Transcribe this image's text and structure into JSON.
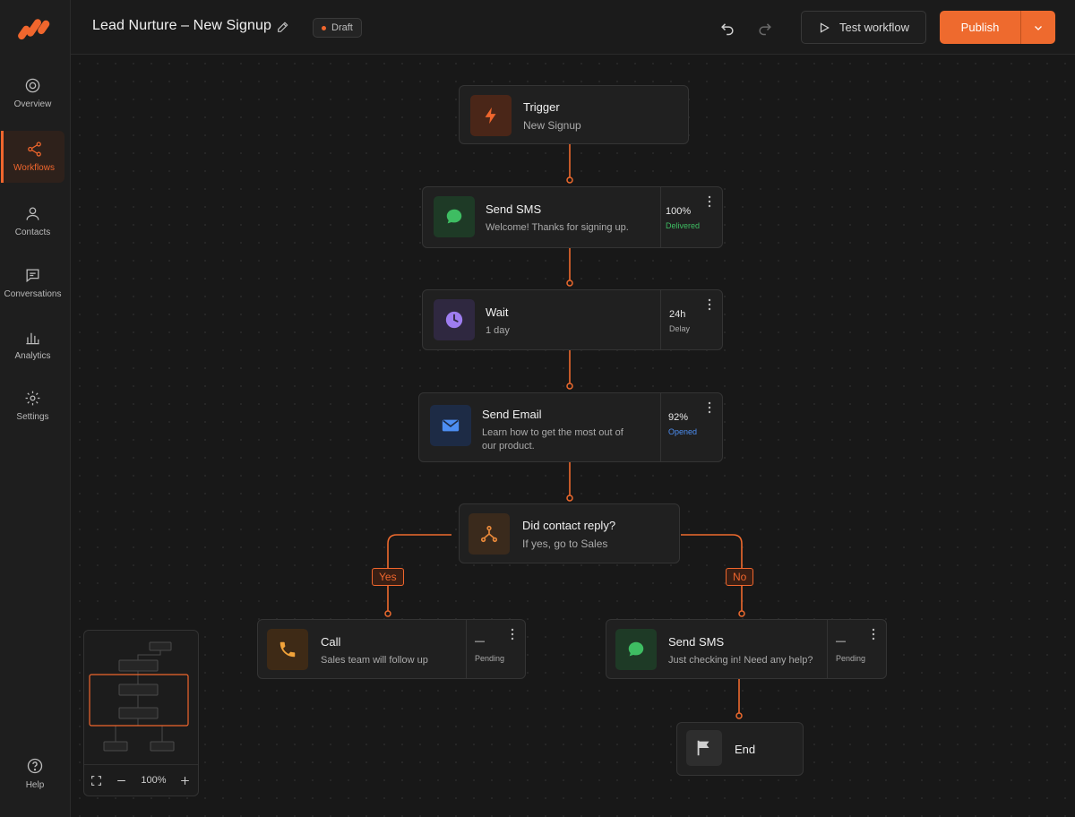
{
  "app": {
    "title": "Lead Nurture – New Signup",
    "status": "Draft",
    "accent": "#ee6a2e"
  },
  "sidebar": {
    "items": [
      {
        "label": "Overview",
        "icon": "target-icon"
      },
      {
        "label": "Workflows",
        "icon": "workflow-icon",
        "active": true
      },
      {
        "label": "Contacts",
        "icon": "user-icon"
      },
      {
        "label": "Conversations",
        "icon": "chat-icon"
      },
      {
        "label": "Analytics",
        "icon": "bar-chart-icon"
      },
      {
        "label": "Settings",
        "icon": "gear-icon"
      }
    ],
    "help": "Help"
  },
  "toolbar": {
    "test_label": "Test workflow",
    "publish_label": "Publish"
  },
  "nodes": {
    "trigger": {
      "title": "Trigger",
      "subtitle": "New Signup"
    },
    "sms1": {
      "title": "Send SMS",
      "subtitle": "Welcome! Thanks for signing up.",
      "stat_value": "100%",
      "stat_label": "Delivered"
    },
    "wait": {
      "title": "Wait",
      "subtitle": "1 day",
      "stat_value": "24h",
      "stat_label": "Delay"
    },
    "email": {
      "title": "Send Email",
      "subtitle": "Learn how to get the most out of our product.",
      "stat_value": "92%",
      "stat_label": "Opened"
    },
    "condition": {
      "title": "Did contact reply?",
      "subtitle": "If yes, go to Sales"
    },
    "call": {
      "title": "Call",
      "subtitle": "Sales team will follow up",
      "stat_value": "—",
      "stat_label": "Pending"
    },
    "sms2": {
      "title": "Send SMS",
      "subtitle": "Just checking in! Need any help?",
      "stat_value": "—",
      "stat_label": "Pending"
    },
    "end": {
      "title": "End"
    }
  },
  "branches": {
    "yes": "Yes",
    "no": "No"
  },
  "minimap": {
    "zoom": "100%"
  }
}
